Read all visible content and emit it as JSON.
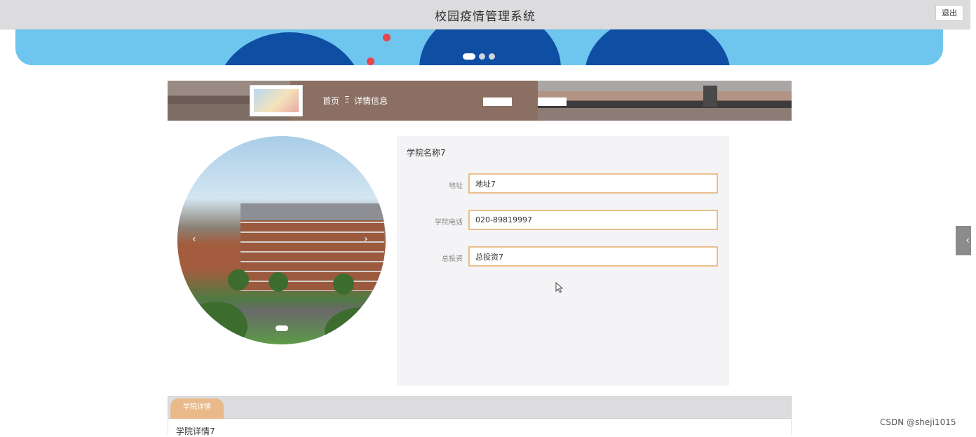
{
  "header": {
    "title": "校园疫情管理系统",
    "logout_label": "退出"
  },
  "banner": {
    "slides": 3,
    "active_slide": 1
  },
  "breadcrumb": {
    "home": "首页",
    "separator": "Ξ",
    "current": "详情信息"
  },
  "side_tab": {
    "glyph": "‹"
  },
  "gallery": {
    "prev_glyph": "‹",
    "next_glyph": "›",
    "slides": 1,
    "active_slide": 1
  },
  "detail": {
    "name": "学院名称7",
    "fields": [
      {
        "label": "地址",
        "value": "地址7"
      },
      {
        "label": "学院电话",
        "value": "020-89819997"
      },
      {
        "label": "总投资",
        "value": "总投资7"
      }
    ]
  },
  "tabs": {
    "active_label": "学院详情"
  },
  "content": {
    "text": "学院详情7"
  },
  "watermark": "CSDN @sheji1015",
  "colors": {
    "accent": "#e9b98a",
    "banner": "#6ec6ef",
    "header_bg": "#dcdcdf"
  }
}
